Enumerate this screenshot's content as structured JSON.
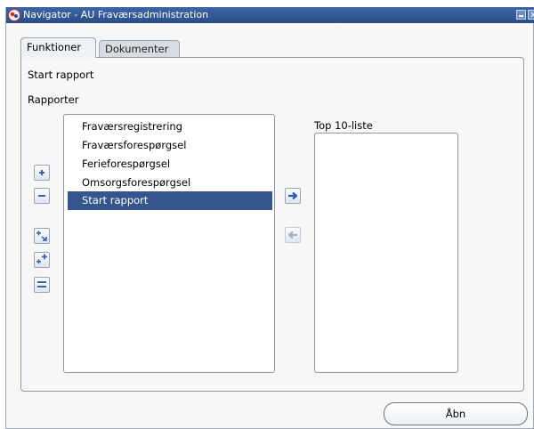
{
  "window": {
    "title": "Navigator - AU Fraværsadministration"
  },
  "tabs": [
    {
      "label": "Funktioner",
      "active": true
    },
    {
      "label": "Dokumenter",
      "active": false
    }
  ],
  "panel": {
    "function_label": "Start rapport",
    "section_label": "Rapporter",
    "available_list": {
      "items": [
        {
          "label": "Fraværsregistrering"
        },
        {
          "label": "Fraværsforespørgsel"
        },
        {
          "label": "Ferieforespørgsel"
        },
        {
          "label": "Omsorgsforespørgsel"
        },
        {
          "label": "Start rapport",
          "selected": true
        }
      ]
    },
    "top10": {
      "label": "Top 10-liste",
      "items": []
    }
  },
  "tools": {
    "expand_icon": "plus-icon",
    "collapse_icon": "minus-icon",
    "expand_branch_icon": "expand-branch-icon",
    "expand_all_icon": "expand-all-icon",
    "collapse_all_icon": "collapse-all-icon",
    "add_icon": "arrow-right-icon",
    "remove_icon": "arrow-left-icon"
  },
  "footer": {
    "open_button": "Åbn"
  },
  "colors": {
    "titlebar": "#2b4e86",
    "selection": "#34568c",
    "window_bg": "#f7f7f5"
  }
}
